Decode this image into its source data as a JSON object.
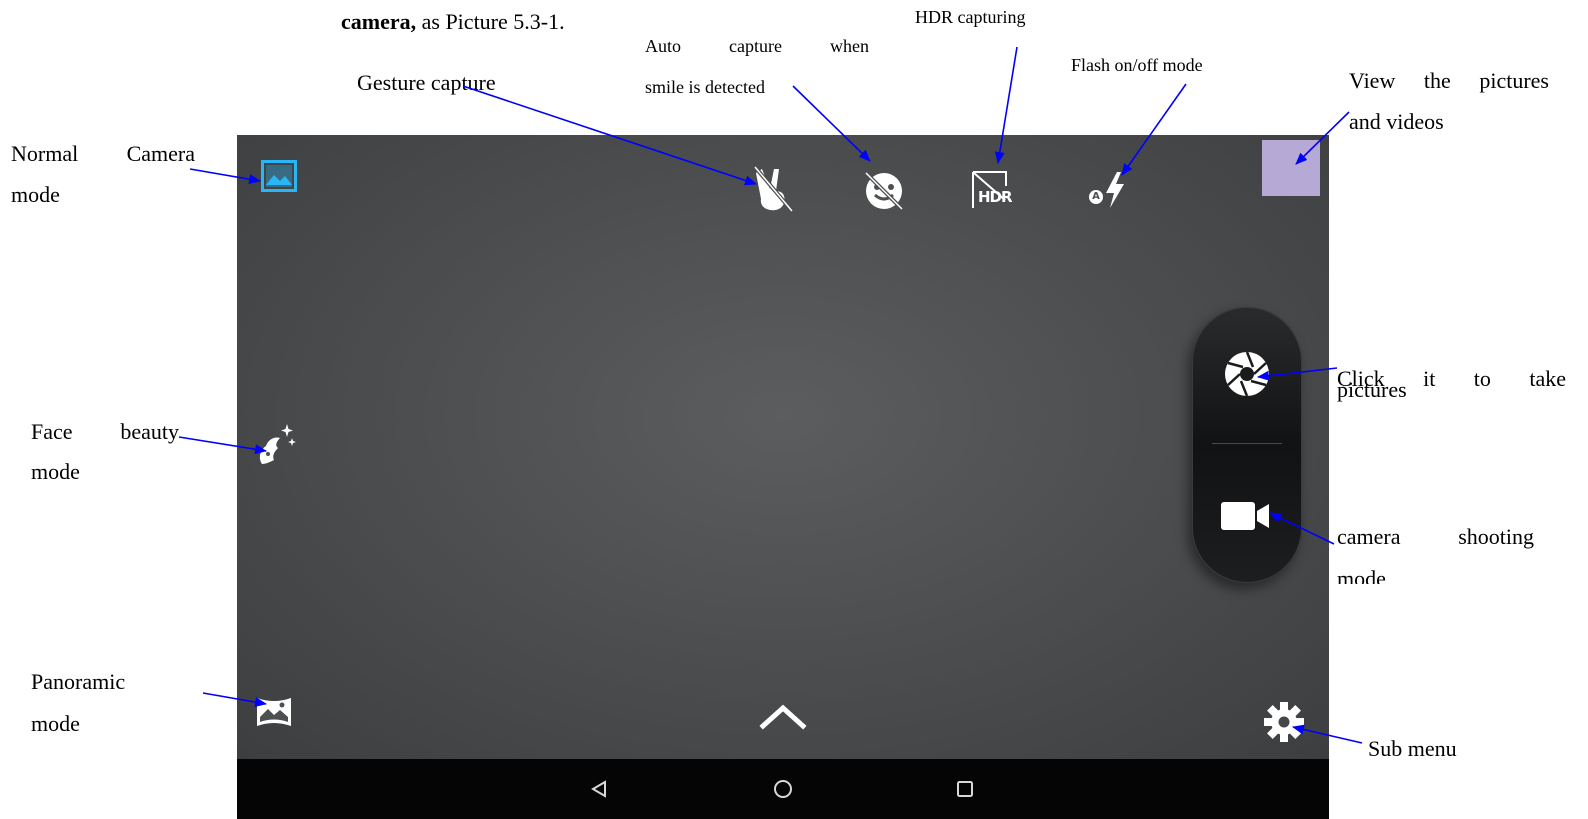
{
  "intro": {
    "bold": "camera,",
    "rest": " as Picture 5.3-1."
  },
  "labels": {
    "gesture": "Gesture capture",
    "smile_line1": [
      "Auto",
      "capture",
      "when"
    ],
    "smile_line2": "smile is detected",
    "hdr": "HDR capturing",
    "flash": "Flash on/off mode",
    "view_line1": [
      "View",
      "the",
      "pictures"
    ],
    "view_line2": "and videos",
    "normal_line1": [
      "Normal",
      "Camera"
    ],
    "normal_line2": "mode",
    "face_line1": [
      "Face",
      "beauty"
    ],
    "face_line2": "mode",
    "pano_line1": "Panoramic",
    "pano_line2": "mode",
    "take_line1": [
      "Click",
      "it",
      "to",
      "take"
    ],
    "take_line2": "pictures",
    "video_line1": [
      "camera",
      "shooting"
    ],
    "video_line2": "mode",
    "submenu": "Sub menu"
  },
  "icons": {
    "normal_mode": "normal-camera-icon",
    "face_beauty": "face-beauty-icon",
    "panorama": "panorama-icon",
    "gesture": "gesture-capture-icon",
    "smile": "smile-capture-icon",
    "hdr_text": "HDR",
    "flash_badge": "A",
    "shutter": "shutter-icon",
    "video": "video-camera-icon",
    "settings": "gear-icon",
    "expand": "chevron-up-icon",
    "nav_back": "back-icon",
    "nav_home": "home-icon",
    "nav_recents": "recents-icon"
  },
  "colors": {
    "accent": "#29b6f6",
    "arrow": "#0000ff",
    "thumbnail": "#b7a9d6"
  }
}
